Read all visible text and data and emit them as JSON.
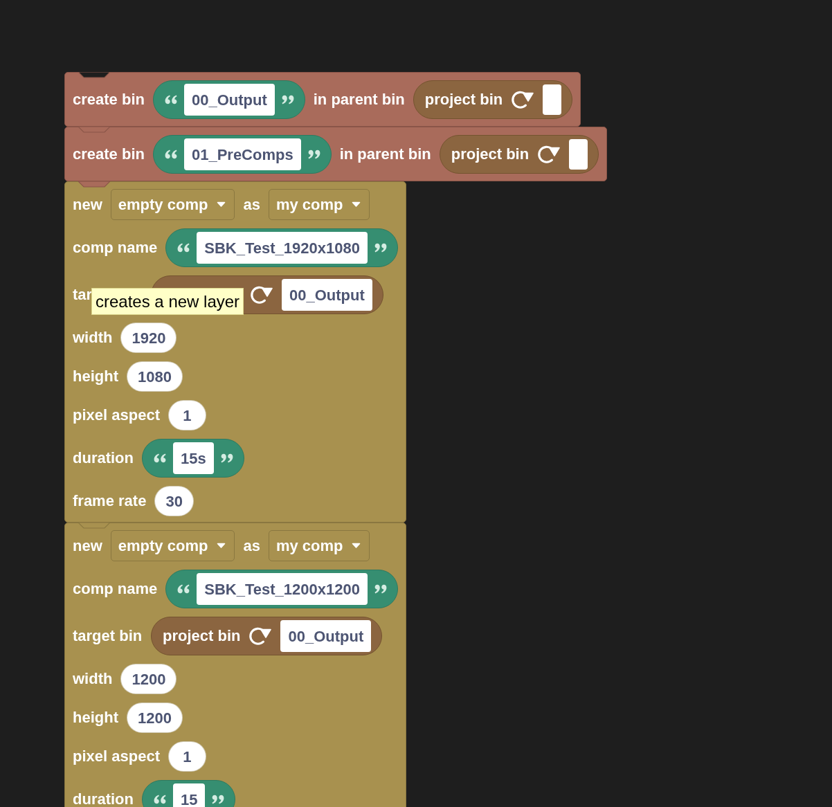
{
  "blocks": [
    {
      "kind": "create_bin",
      "label": "create bin",
      "name": "00_Output",
      "parent_label": "in parent bin",
      "parent": "project bin"
    },
    {
      "kind": "create_bin",
      "label": "create bin",
      "name": "01_PreComps",
      "parent_label": "in parent bin",
      "parent": "project bin"
    },
    {
      "kind": "new_comp",
      "rows": [
        {
          "kind": "dropdowns",
          "label": "new",
          "source": "empty comp",
          "joiner": "as",
          "variable": "my comp"
        },
        {
          "kind": "string",
          "label": "comp name",
          "value": "SBK_Test_1920x1080"
        },
        {
          "kind": "bin",
          "label": "tar",
          "value": "00_Output"
        },
        {
          "kind": "number",
          "label": "width",
          "value": "1920"
        },
        {
          "kind": "number",
          "label": "height",
          "value": "1080"
        },
        {
          "kind": "number",
          "label": "pixel aspect",
          "value": "1"
        },
        {
          "kind": "string",
          "label": "duration",
          "value": "15s"
        },
        {
          "kind": "number",
          "label": "frame rate",
          "value": "30"
        }
      ]
    },
    {
      "kind": "new_comp",
      "rows": [
        {
          "kind": "dropdowns",
          "label": "new",
          "source": "empty comp",
          "joiner": "as",
          "variable": "my comp"
        },
        {
          "kind": "string",
          "label": "comp name",
          "value": "SBK_Test_1200x1200"
        },
        {
          "kind": "bin",
          "label": "target bin",
          "reporter": "project bin",
          "value": "00_Output"
        },
        {
          "kind": "number",
          "label": "width",
          "value": "1200"
        },
        {
          "kind": "number",
          "label": "height",
          "value": "1200"
        },
        {
          "kind": "number",
          "label": "pixel aspect",
          "value": "1"
        },
        {
          "kind": "string",
          "label": "duration",
          "value": "15"
        }
      ]
    }
  ],
  "tooltip": {
    "text": "creates a new layer"
  }
}
